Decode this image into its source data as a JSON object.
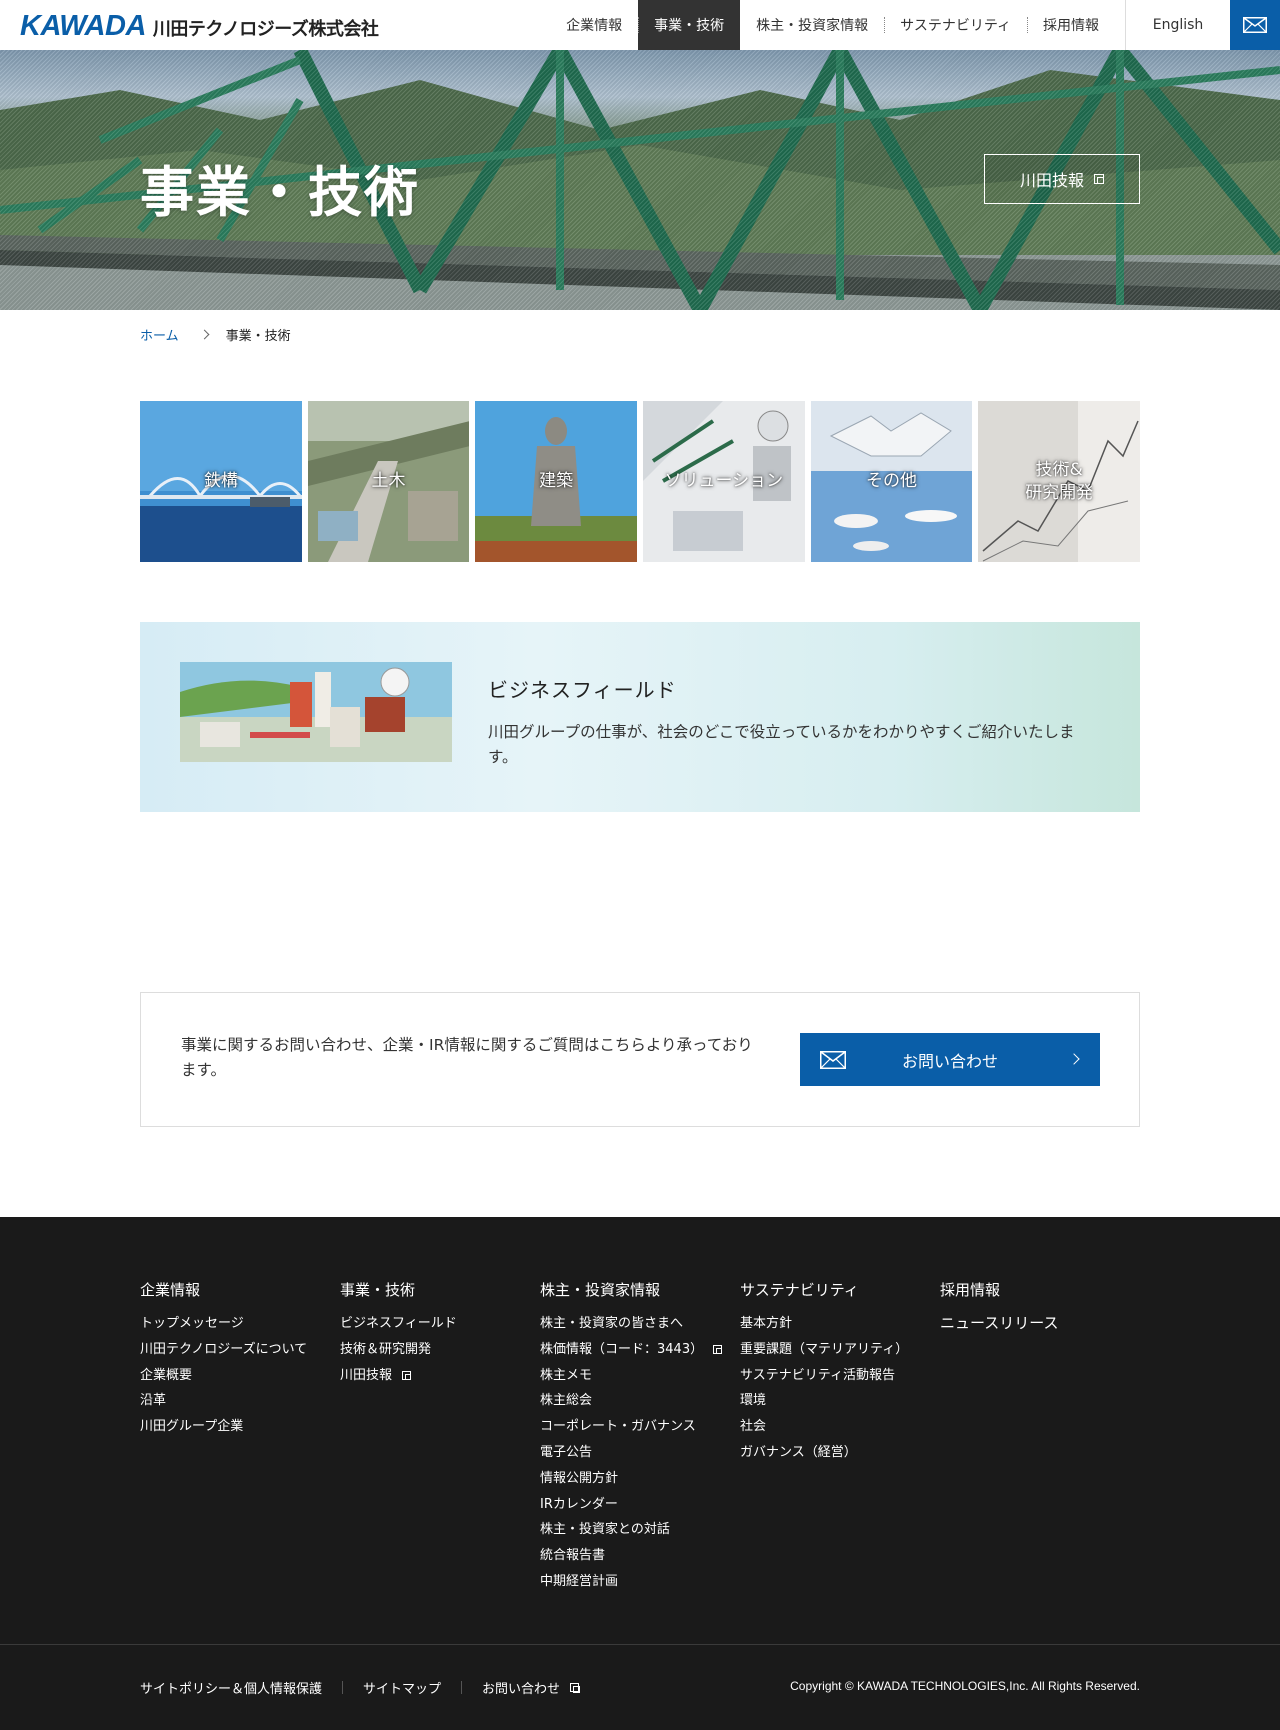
{
  "header": {
    "logo_mark": "KAWADA",
    "logo_text": "川田テクノロジーズ株式会社",
    "nav": [
      "企業情報",
      "事業・技術",
      "株主・投資家情報",
      "サステナビリティ",
      "採用情報"
    ],
    "english": "English"
  },
  "hero": {
    "title": "事業・技術",
    "button": "川田技報"
  },
  "breadcrumb": {
    "home": "ホーム",
    "current": "事業・技術"
  },
  "tiles": [
    "鉄構",
    "土木",
    "建築",
    "ソリューション",
    "その他",
    "技術&\n研究開発"
  ],
  "business_field": {
    "title": "ビジネスフィールド",
    "description": "川田グループの仕事が、社会のどこで役立っているかをわかりやすくご紹介いたします。"
  },
  "contact": {
    "text": "事業に関するお問い合わせ、企業・IR情報に関するご質問はこちらより承っております。",
    "button": "お問い合わせ"
  },
  "footer": {
    "columns": [
      {
        "title": "企業情報",
        "items": [
          "トップメッセージ",
          "川田テクノロジーズについて",
          "企業概要",
          "沿革",
          "川田グループ企業"
        ]
      },
      {
        "title": "事業・技術",
        "items": [
          "ビジネスフィールド",
          "技術＆研究開発",
          "川田技報"
        ]
      },
      {
        "title": "株主・投資家情報",
        "items": [
          "株主・投資家の皆さまへ",
          "株価情報（コード：3443）",
          "株主メモ",
          "株主総会",
          "コーポレート・ガバナンス",
          "電子公告",
          "情報公開方針",
          "IRカレンダー",
          "株主・投資家との対話",
          "統合報告書",
          "中期経営計画"
        ]
      },
      {
        "title": "サステナビリティ",
        "items": [
          "基本方針",
          "重要課題（マテリアリティ）",
          "サステナビリティ活動報告",
          "環境",
          "社会",
          "ガバナンス（経営）"
        ]
      },
      {
        "title": "採用情報",
        "items": []
      }
    ],
    "news": "ニュースリリース",
    "bottom_links": [
      "サイトポリシー＆個人情報保護",
      "サイトマップ",
      "お問い合わせ"
    ],
    "copyright": "Copyright © KAWADA TECHNOLOGIES,Inc. All Rights Reserved."
  }
}
